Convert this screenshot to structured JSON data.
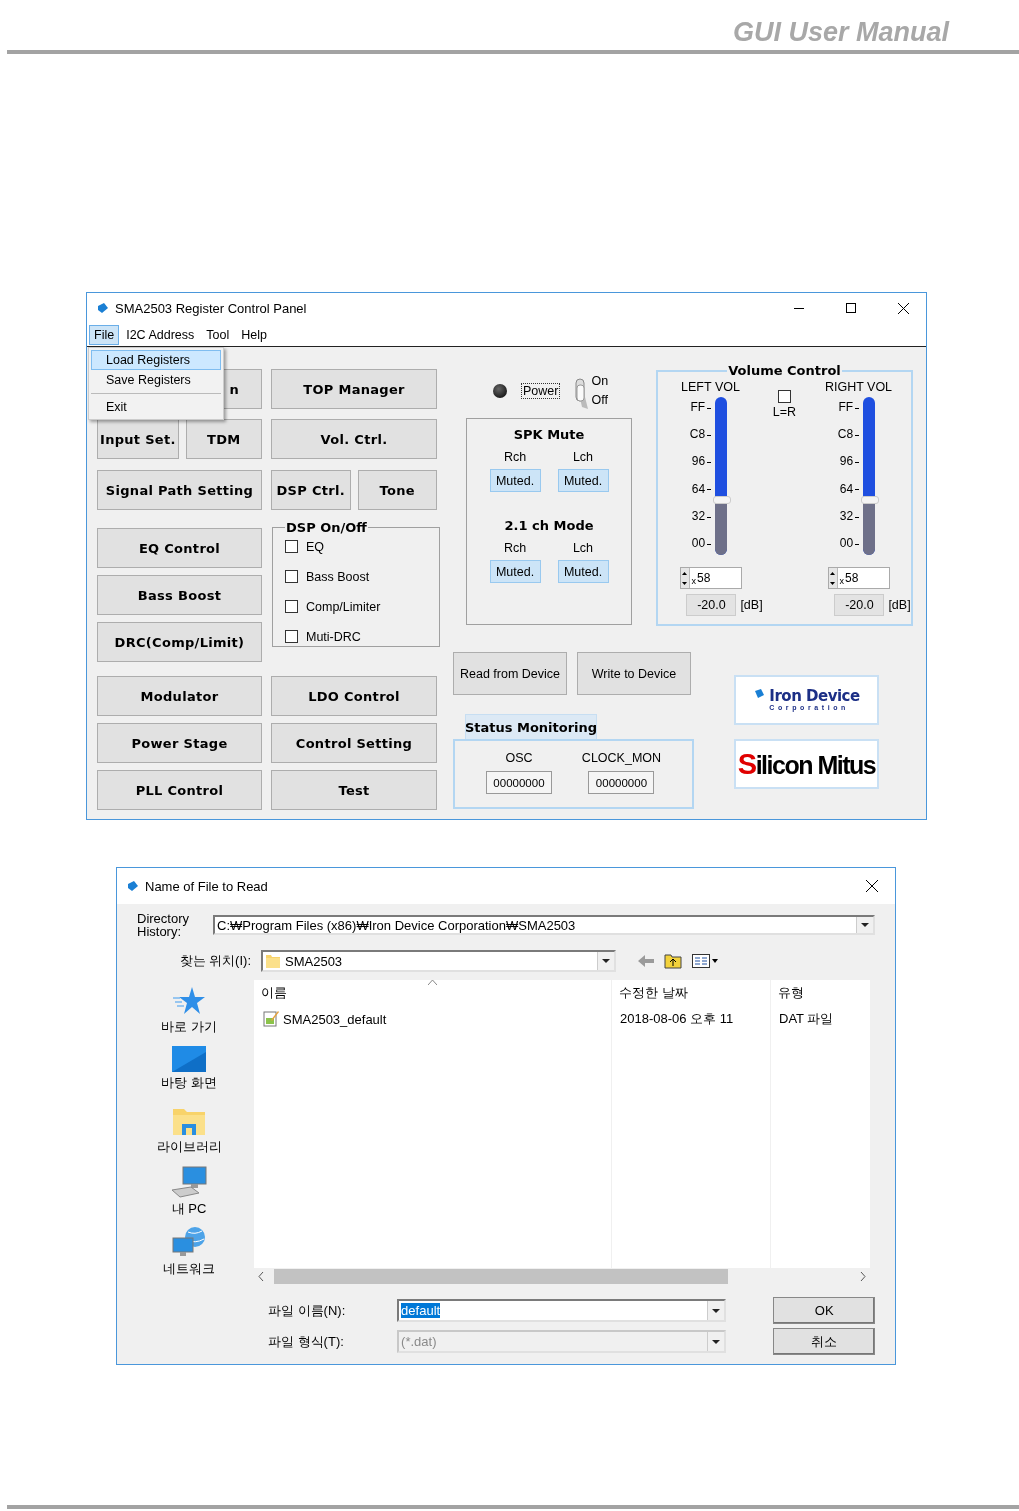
{
  "page_header": {
    "title": "GUI User Manual"
  },
  "panel": {
    "title": "SMA2503 Register Control Panel",
    "menu": [
      {
        "label": "File",
        "selected": true
      },
      {
        "label": "I2C Address",
        "selected": false
      },
      {
        "label": "Tool",
        "selected": false
      },
      {
        "label": "Help",
        "selected": false
      }
    ],
    "file_menu": [
      {
        "label": "Load Registers",
        "selected": true
      },
      {
        "label": "Save Registers",
        "selected": false
      },
      {
        "label": "Exit",
        "selected": false
      }
    ],
    "column_a": [
      [
        "n"
      ],
      [
        "Input Set.",
        "TDM"
      ],
      [
        "Signal Path Setting"
      ],
      [
        "EQ Control"
      ],
      [
        "Bass Boost"
      ],
      [
        "DRC(Comp/Limit)"
      ],
      [
        "Modulator"
      ],
      [
        "Power Stage"
      ],
      [
        "PLL Control"
      ]
    ],
    "column_b": [
      [
        "TOP Manager"
      ],
      [
        "Vol. Ctrl."
      ],
      [
        "DSP Ctrl.",
        "Tone"
      ],
      [
        "LDO Control"
      ],
      [
        "Control Setting"
      ],
      [
        "Test"
      ]
    ],
    "dsp_group": {
      "title": "DSP On/Off",
      "options": [
        {
          "label": "EQ",
          "checked": false
        },
        {
          "label": "Bass Boost",
          "checked": false
        },
        {
          "label": "Comp/Limiter",
          "checked": false
        },
        {
          "label": "Muti-DRC",
          "checked": false
        }
      ]
    },
    "power": {
      "label": "Power",
      "on": false,
      "switch_on": "On",
      "switch_off": "Off"
    },
    "spk_mute": {
      "title": "SPK Mute",
      "channels": [
        {
          "label": "Rch",
          "button": "Muted."
        },
        {
          "label": "Lch",
          "button": "Muted."
        }
      ]
    },
    "mode_21": {
      "title": "2.1 ch Mode",
      "channels": [
        {
          "label": "Rch",
          "button": "Muted."
        },
        {
          "label": "Lch",
          "button": "Muted."
        }
      ]
    },
    "volume": {
      "title": "Volume Control",
      "link": {
        "label": "L=R",
        "checked": false
      },
      "channels": [
        {
          "label": "LEFT VOL",
          "ticks": [
            "FF",
            "C8",
            "96",
            "64",
            "32",
            "00"
          ],
          "level": 0.35,
          "prefix": "x",
          "hex": "58",
          "db": "-20.0",
          "unit": "[dB]"
        },
        {
          "label": "RIGHT VOL",
          "ticks": [
            "FF",
            "C8",
            "96",
            "64",
            "32",
            "00"
          ],
          "level": 0.35,
          "prefix": "x",
          "hex": "58",
          "db": "-20.0",
          "unit": "[dB]"
        }
      ]
    },
    "device_buttons": [
      "Read from Device",
      "Write to Device"
    ],
    "status": {
      "tab": "Status Monitoring",
      "fields": [
        {
          "label": "OSC",
          "value": "00000000"
        },
        {
          "label": "CLOCK_MON",
          "value": "00000000"
        }
      ]
    },
    "logos": [
      {
        "name": "Iron Device",
        "sub": "Corporation"
      },
      {
        "name": "Silicon Mitus"
      }
    ]
  },
  "dialog": {
    "title": "Name of File to Read",
    "history": {
      "label": "Directory History:",
      "value": "C:₩Program Files (x86)₩Iron Device Corporation₩SMA2503"
    },
    "look_in": {
      "label": "찾는 위치(I):",
      "value": "SMA2503"
    },
    "places": [
      {
        "label": "바로 가기",
        "kind": "quick"
      },
      {
        "label": "바탕 화면",
        "kind": "desktop"
      },
      {
        "label": "라이브러리",
        "kind": "library"
      },
      {
        "label": "내 PC",
        "kind": "pc"
      },
      {
        "label": "네트워크",
        "kind": "network"
      }
    ],
    "columns": [
      {
        "label": "이름",
        "sorted": true
      },
      {
        "label": "수정한 날짜",
        "sorted": false
      },
      {
        "label": "유형",
        "sorted": false
      }
    ],
    "files": [
      {
        "name": "SMA2503_default",
        "date": "2018-08-06 오후 11",
        "type": "DAT 파일",
        "selected": false
      }
    ],
    "file_name": {
      "label": "파일 이름(N):",
      "value": "default",
      "highlighted": true
    },
    "file_type": {
      "label": "파일 형식(T):",
      "value": "(*.dat)",
      "disabled": true
    },
    "buttons": [
      "OK",
      "취소"
    ]
  }
}
